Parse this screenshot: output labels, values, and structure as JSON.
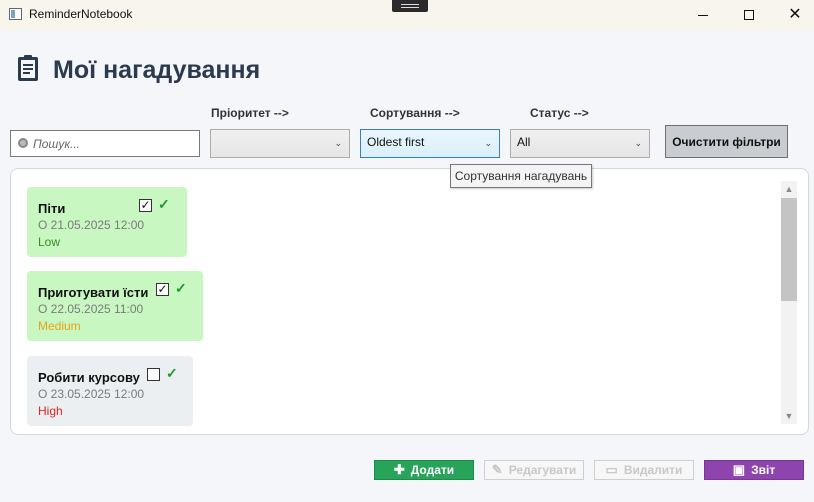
{
  "window": {
    "title": "ReminderNotebook",
    "minimize_glyph": "",
    "close_glyph": "✕"
  },
  "header": {
    "title": "Мої нагадування",
    "icon": "clipboard-icon"
  },
  "filters": {
    "priority_label": "Пріоритет -->",
    "sort_label": "Сортування -->",
    "status_label": "Статус -->",
    "search_placeholder": "Пошук...",
    "search_value": "",
    "priority_value": "",
    "sort_value": "Oldest first",
    "status_value": "All",
    "clear_label": "Очистити фільтри",
    "sort_tooltip": "Сортування нагадувань"
  },
  "reminders": [
    {
      "title": "Піти",
      "date": "О 21.05.2025 12:00",
      "priority": "Low",
      "priority_color": "#3a8a2a",
      "checked": true,
      "bg": "#c9f7c2",
      "check_mark": "✓",
      "tick": "✓"
    },
    {
      "title": "Приготувати їсти",
      "date": "О 22.05.2025 11:00",
      "priority": "Medium",
      "priority_color": "#e8a317",
      "checked": true,
      "bg": "#c9f7c2",
      "check_mark": "✓",
      "tick": "✓"
    },
    {
      "title": "Робити курсову",
      "date": "О 23.05.2025 12:00",
      "priority": "High",
      "priority_color": "#e02424",
      "checked": false,
      "bg": "#eceff1",
      "check_mark": "",
      "tick": "✓"
    }
  ],
  "actions": {
    "add_label": "Додати",
    "edit_label": "Редагувати",
    "delete_label": "Видалити",
    "report_label": "Звіт"
  },
  "colors": {
    "add": "#27a35a",
    "report": "#8e44ad",
    "title": "#2b3a4e"
  }
}
